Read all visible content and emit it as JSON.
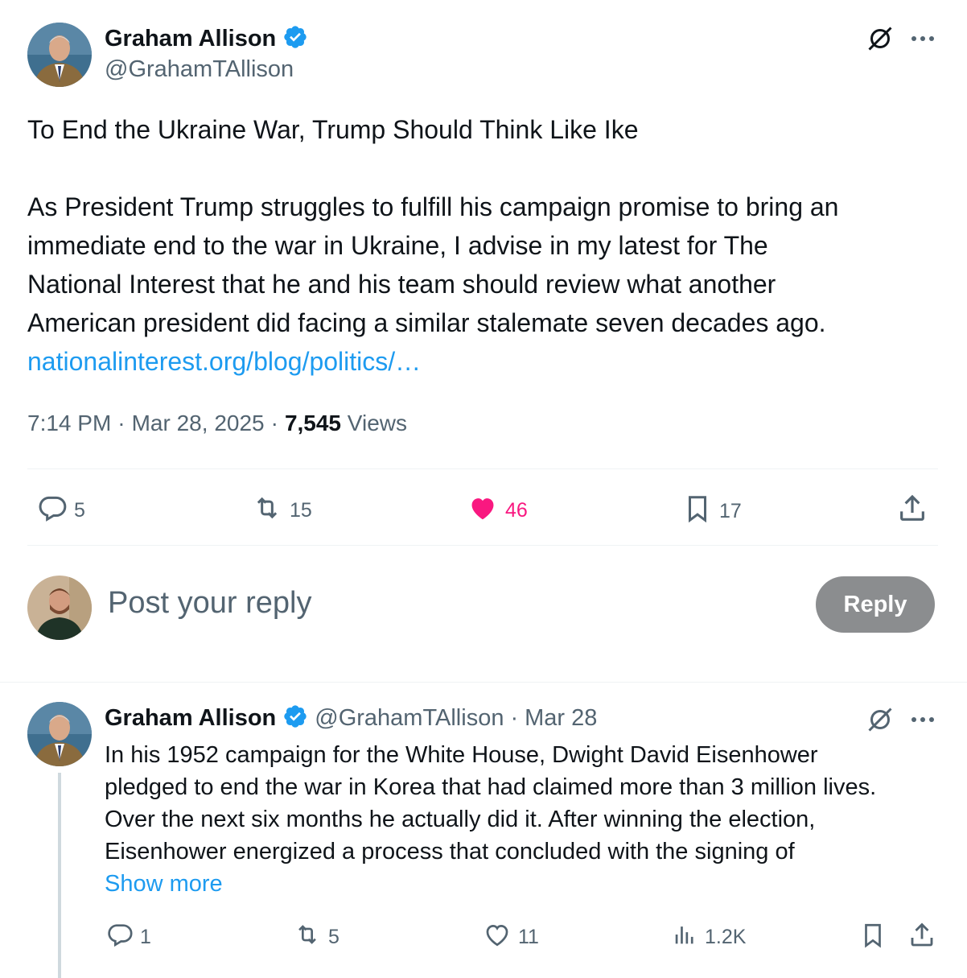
{
  "main_post": {
    "author_name": "Graham Allison",
    "author_handle": "@GrahamTAllison",
    "title": "To End the Ukraine War, Trump Should Think Like Ike",
    "body_lines": [
      "As President Trump struggles to fulfill his campaign promise to bring an",
      "immediate end to the war in Ukraine, I advise in my latest for The",
      "National Interest that he and his team should review what another",
      "American president did facing a similar stalemate seven decades ago."
    ],
    "link_text": "nationalinterest.org/blog/politics/…",
    "time": "7:14 PM",
    "date": "Mar 28, 2025",
    "views_count": "7,545",
    "views_label": "Views",
    "separator": "·",
    "stats": {
      "replies": "5",
      "reposts": "15",
      "likes": "46",
      "bookmarks": "17"
    }
  },
  "composer": {
    "placeholder": "Post your reply",
    "button_label": "Reply"
  },
  "reply_post": {
    "author_name": "Graham Allison",
    "author_handle": "@GrahamTAllison",
    "separator": "·",
    "date": "Mar 28",
    "body_lines": [
      "In his 1952 campaign for the White House, Dwight David Eisenhower",
      "pledged to end the war in Korea that had claimed more than 3 million lives.",
      "Over the next six months he actually did it. After winning the election,",
      "Eisenhower energized a process that concluded with the signing of"
    ],
    "show_more": "Show more",
    "stats": {
      "replies": "1",
      "reposts": "5",
      "likes": "11",
      "views": "1.2K"
    }
  },
  "icons": [
    "grok-icon",
    "more-icon",
    "verified-badge-icon",
    "reply-icon",
    "repost-icon",
    "like-icon",
    "bookmark-icon",
    "share-icon",
    "views-icon"
  ],
  "colors": {
    "accent": "#1d9bf0",
    "like": "#f91880",
    "text_primary": "#0f1419",
    "text_secondary": "#536471",
    "reply_button_bg": "#8b8d8f"
  }
}
